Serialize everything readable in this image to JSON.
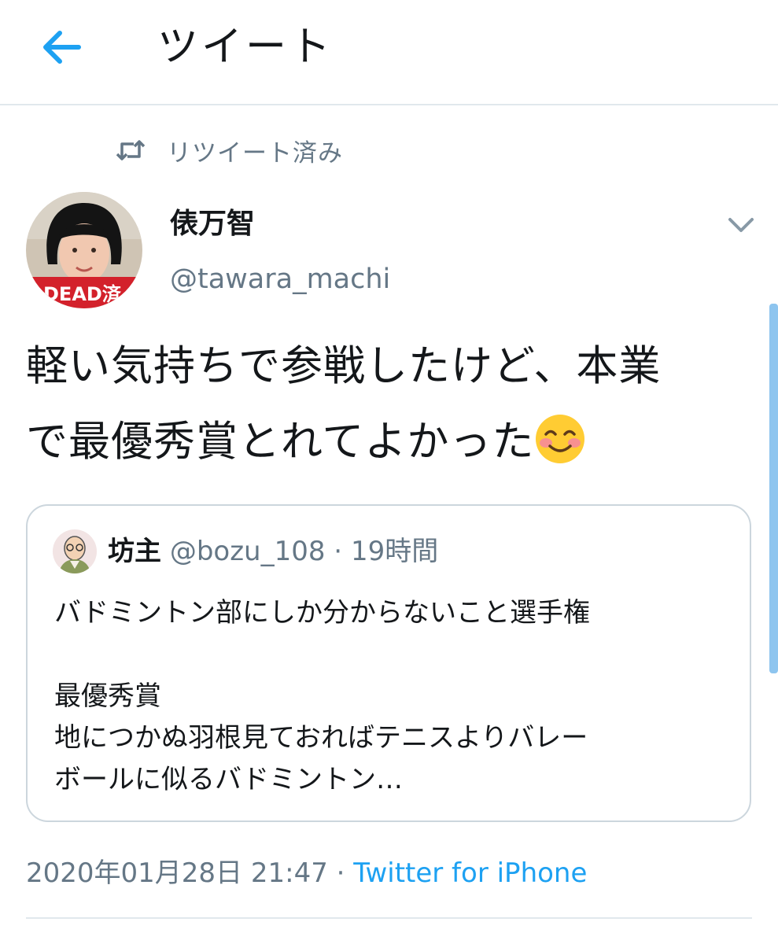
{
  "header": {
    "title": "ツイート",
    "back_icon": "arrow-left-icon",
    "accent_color": "#1da1f2"
  },
  "retweet_banner": {
    "icon": "retweet-icon",
    "label": "リツイート済み"
  },
  "tweet": {
    "author": {
      "display_name": "俵万智",
      "handle": "@tawara_machi",
      "avatar_badge": "DEAD済"
    },
    "more_icon": "chevron-down-icon",
    "text_line1": "軽い気持ちで参戦したけど、本業",
    "text_line2": "で最優秀賞とれてよかった",
    "emoji": "smiling-face-icon",
    "quoted": {
      "display_name": "坊主",
      "handle": "@bozu_108",
      "separator": " · ",
      "time": "19時間",
      "lines": [
        "バドミントン部にしか分からないこと選手権",
        "",
        "最優秀賞",
        "地につかぬ羽根見ておればテニスよりバレー",
        "ボールに似るバドミントン…"
      ]
    },
    "meta": {
      "date": "2020年01月28日 21:47",
      "separator": " · ",
      "source": "Twitter for iPhone"
    }
  }
}
